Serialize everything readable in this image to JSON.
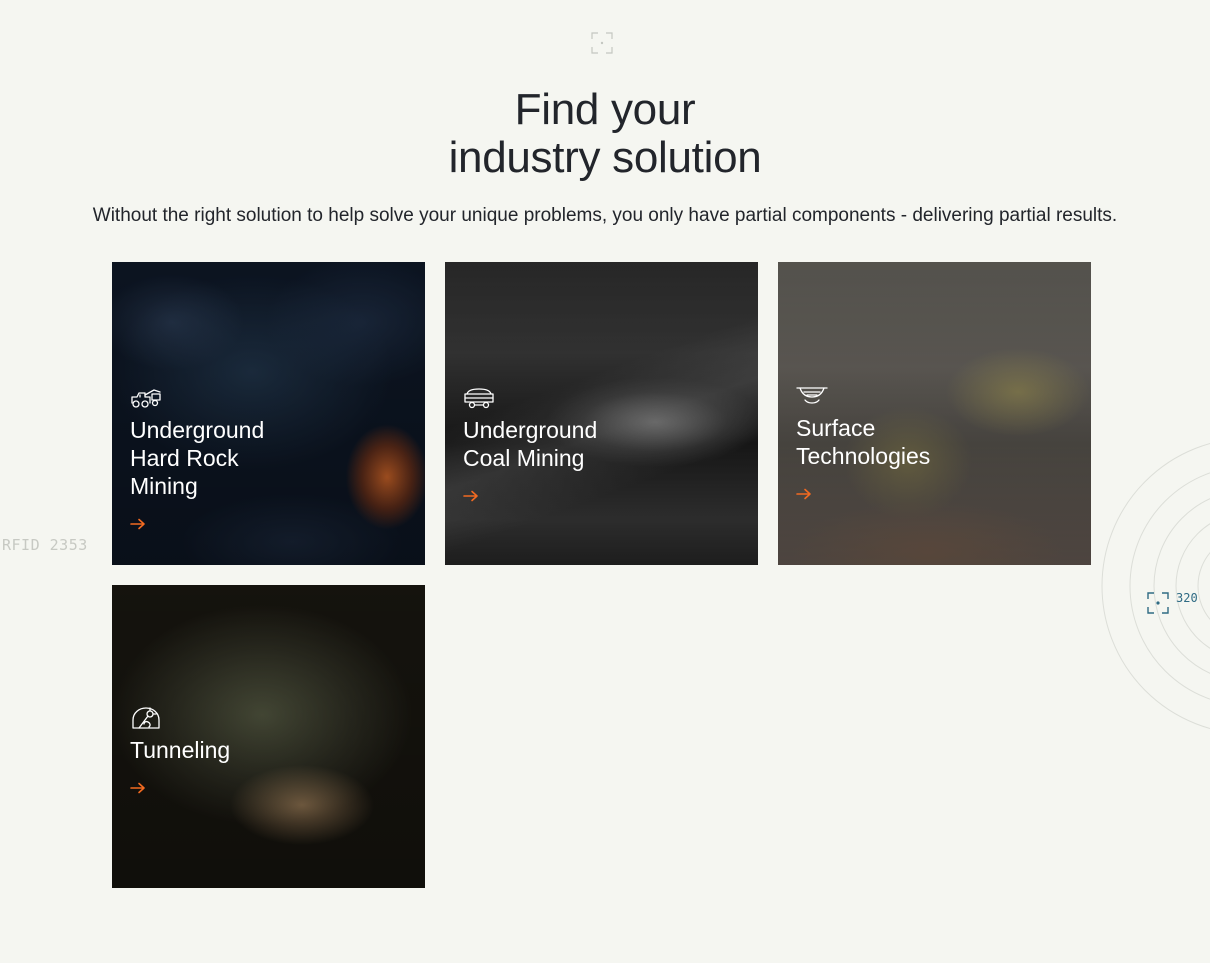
{
  "header": {
    "title_line1": "Find your",
    "title_line2": "industry solution",
    "subtitle": "Without the right solution to help solve your unique problems, you only have partial components - delivering partial results."
  },
  "cards": [
    {
      "label": "Underground\nHard Rock\nMining",
      "icon": "drill-rig-icon"
    },
    {
      "label": "Underground\nCoal Mining",
      "icon": "mine-cart-icon"
    },
    {
      "label": "Surface\nTechnologies",
      "icon": "open-pit-icon"
    },
    {
      "label": "Tunneling",
      "icon": "tunnel-boring-icon"
    }
  ],
  "decorations": {
    "rfid_label": "RFID 2353",
    "coordinate": "320"
  },
  "colors": {
    "accent": "#f26a21",
    "background": "#f5f6f1",
    "text": "#22252b",
    "focus_teal": "#2f6b84"
  }
}
